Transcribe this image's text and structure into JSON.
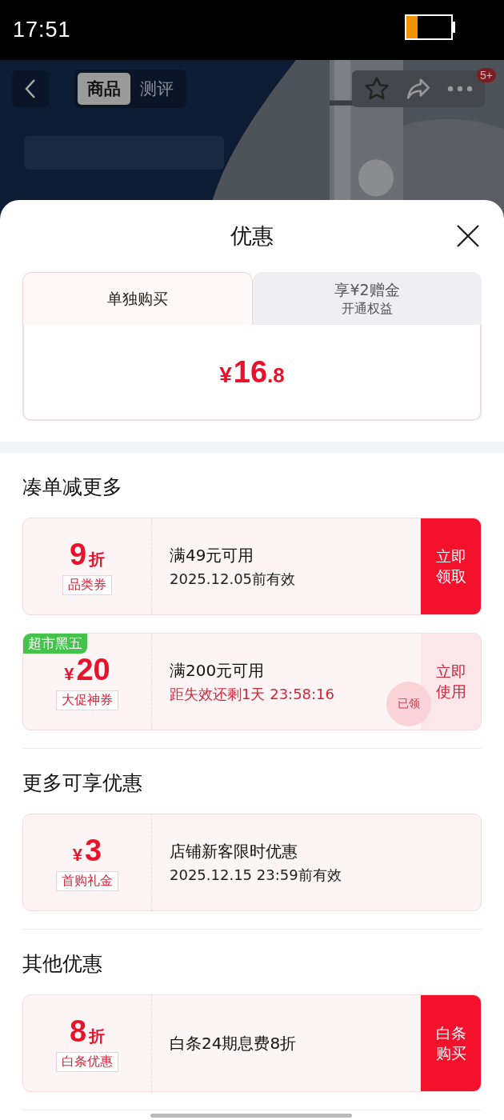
{
  "status_bar": {
    "time": "17:51"
  },
  "nav": {
    "tabs": [
      {
        "label": "商品",
        "selected": true
      },
      {
        "label": "测评",
        "selected": false
      }
    ],
    "badge": "5+"
  },
  "sheet": {
    "title": "优惠",
    "price_tabs": [
      {
        "label": "单独购买",
        "selected": true
      },
      {
        "label": "享¥2赠金",
        "sub": "开通权益",
        "selected": false
      }
    ],
    "price": {
      "currency": "¥",
      "main": "16",
      "decimal": ".8"
    },
    "sections": [
      {
        "heading": "凑单减更多",
        "coupons": [
          {
            "kind": "discount",
            "value": "9",
            "unit": "折",
            "tag": "品类券",
            "title": "满49元可用",
            "note": "2025.12.05前有效",
            "urgent": false,
            "action": {
              "label": "立即领取",
              "kind": "primary"
            }
          },
          {
            "kind": "cash",
            "currency": "¥",
            "value": "20",
            "tag": "大促神券",
            "ribbon": "超市黑五",
            "title": "满200元可用",
            "note": "距失效还剩1天 23:58:16",
            "urgent": true,
            "stamp": "已领",
            "action": {
              "label": "立即使用",
              "kind": "soft"
            }
          }
        ]
      },
      {
        "heading": "更多可享优惠",
        "coupons": [
          {
            "kind": "cash",
            "currency": "¥",
            "value": "3",
            "tag": "首购礼金",
            "title": "店铺新客限时优惠",
            "note": "2025.12.15 23:59前有效",
            "urgent": false
          }
        ]
      },
      {
        "heading": "其他优惠",
        "coupons": [
          {
            "kind": "discount",
            "value": "8",
            "unit": "折",
            "tag": "白条优惠",
            "title": "白条24期息费8折",
            "action": {
              "label": "白条购买",
              "kind": "primary"
            }
          }
        ]
      }
    ]
  }
}
